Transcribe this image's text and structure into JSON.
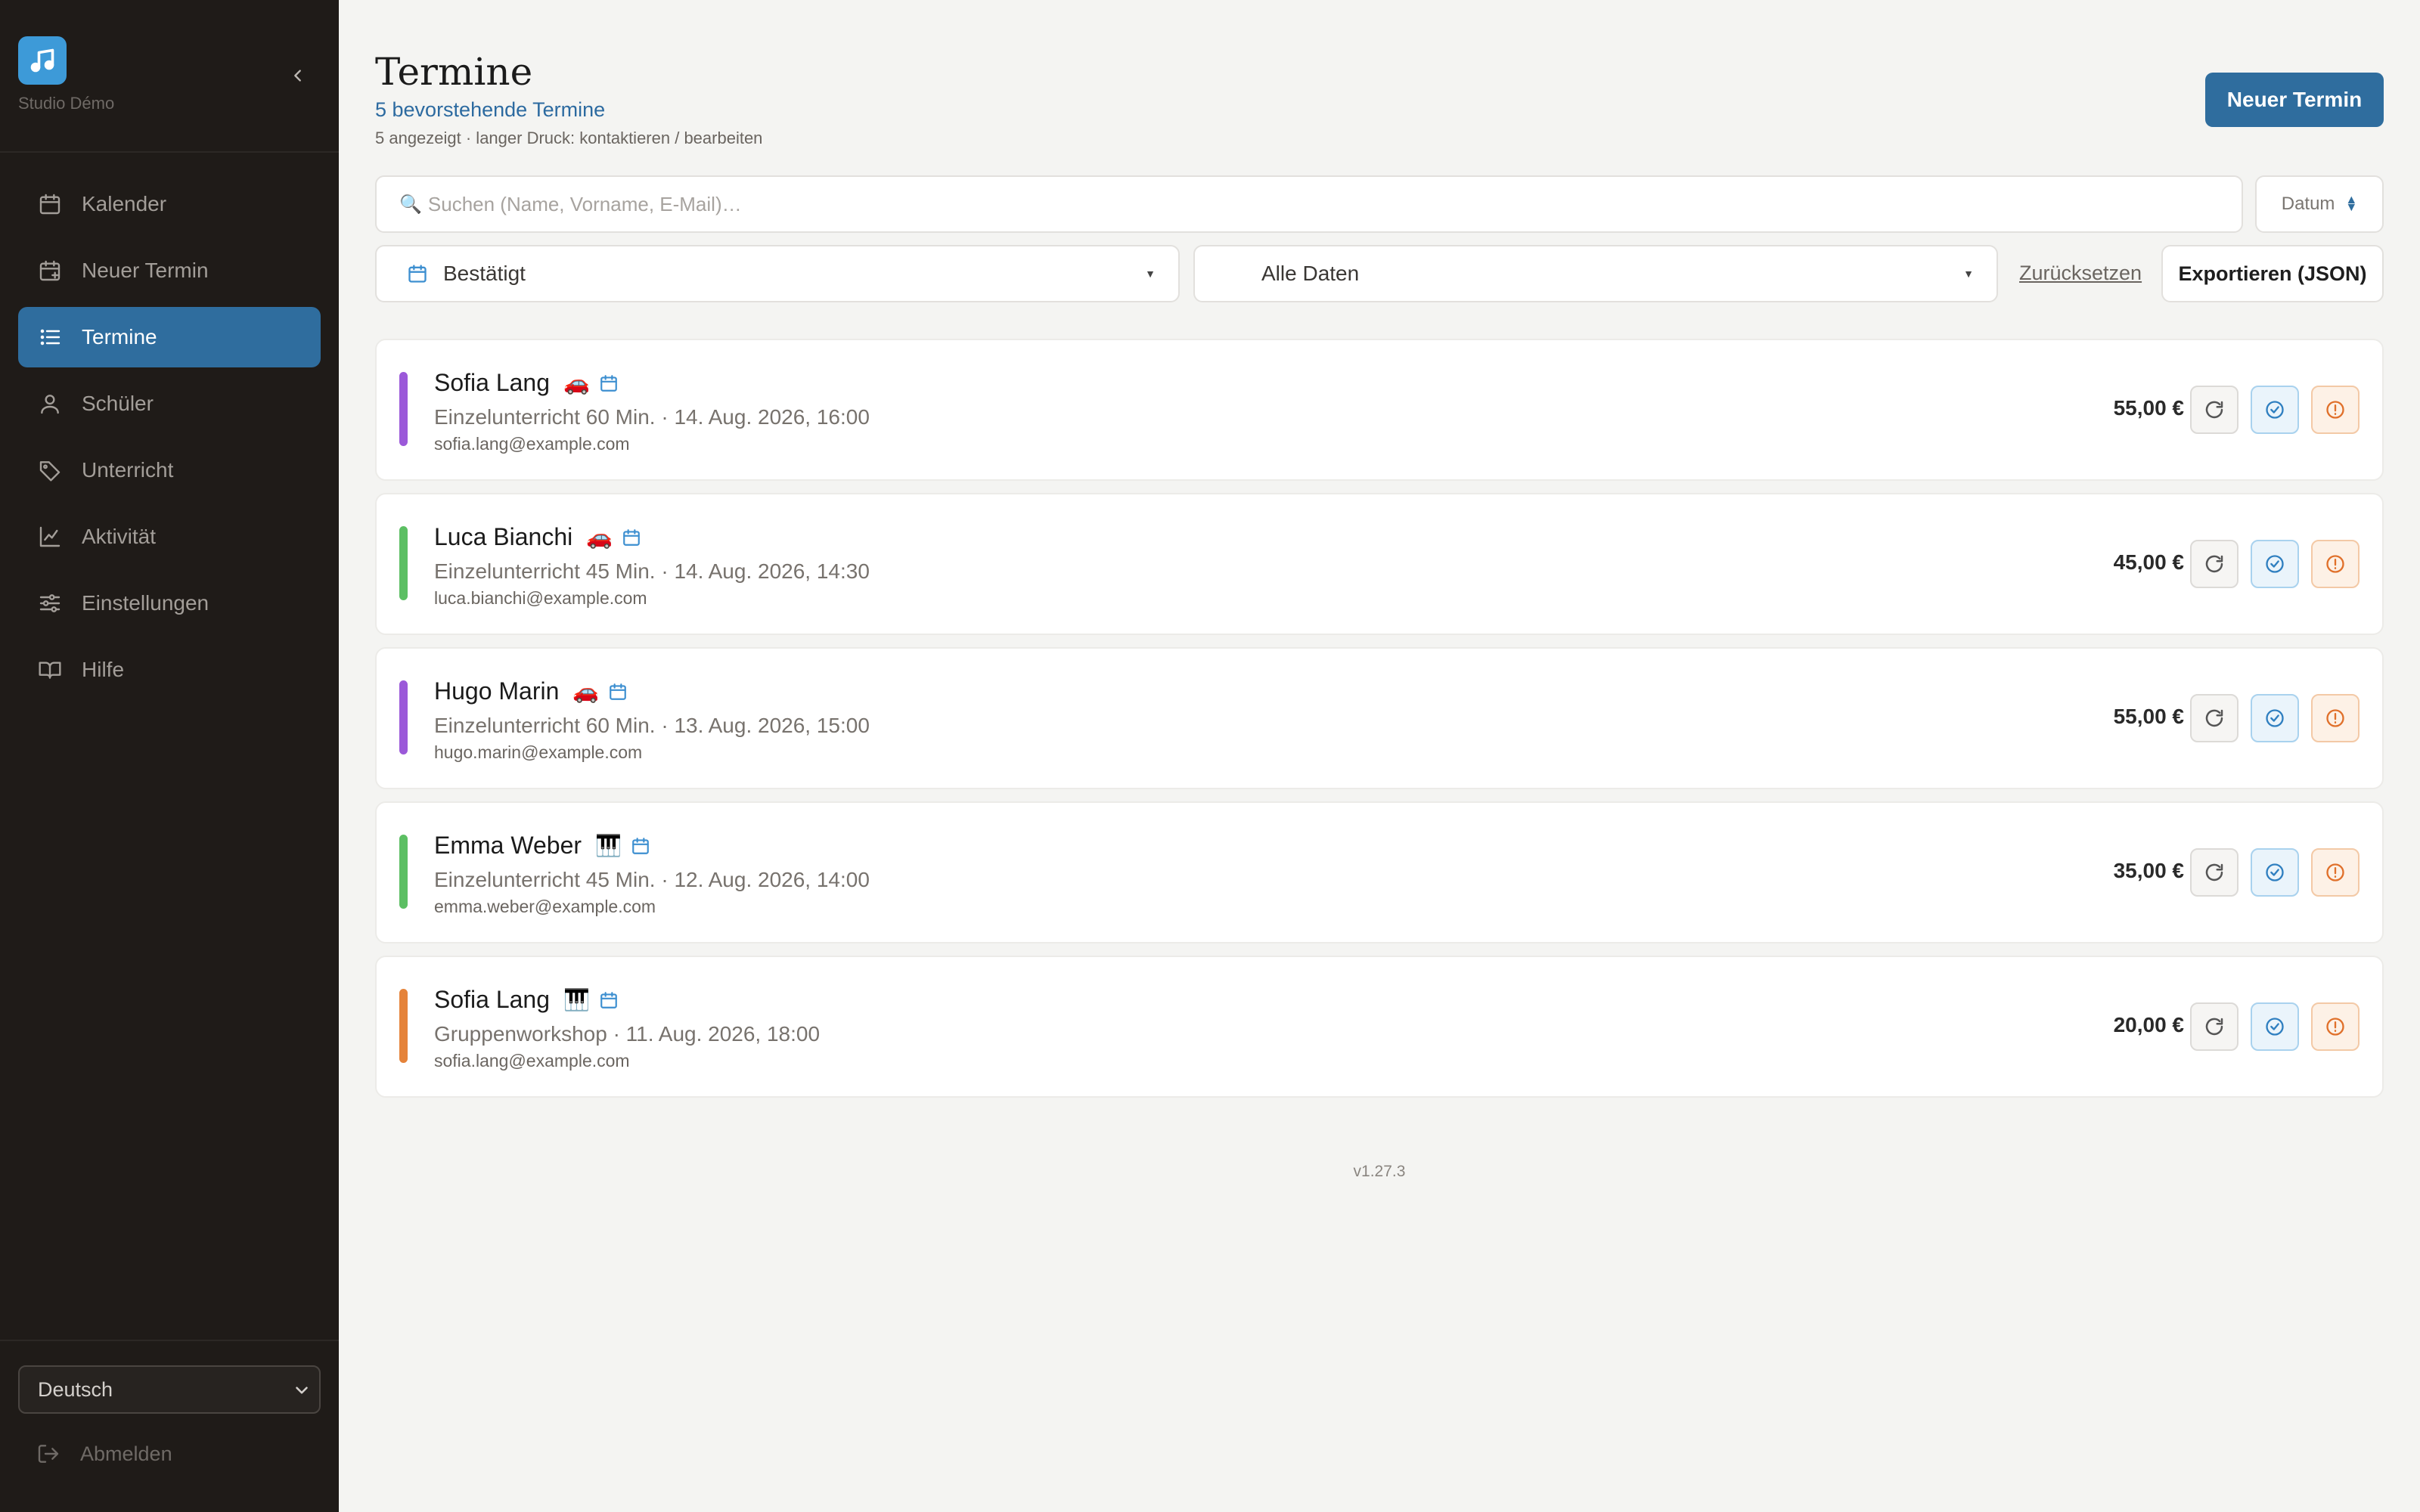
{
  "sidebar": {
    "brand_name": "Studio Démo",
    "nav": [
      {
        "label": "Kalender",
        "icon": "calendar-icon"
      },
      {
        "label": "Neuer Termin",
        "icon": "calendar-plus-icon"
      },
      {
        "label": "Termine",
        "icon": "list-icon",
        "active": true
      },
      {
        "label": "Schüler",
        "icon": "user-icon"
      },
      {
        "label": "Unterricht",
        "icon": "tag-icon"
      },
      {
        "label": "Aktivität",
        "icon": "chart-line-icon"
      },
      {
        "label": "Einstellungen",
        "icon": "sliders-icon"
      },
      {
        "label": "Hilfe",
        "icon": "book-icon"
      }
    ],
    "language": "Deutsch",
    "logout_label": "Abmelden"
  },
  "header": {
    "title": "Termine",
    "subtitle": "5 bevorstehende Termine",
    "hint": "5 angezeigt · langer Druck: kontaktieren / bearbeiten",
    "new_button": "Neuer Termin"
  },
  "filters": {
    "search_placeholder": "Suchen (Name, Vorname, E-Mail)…",
    "sort_label": "Datum",
    "status_value": "Bestätigt",
    "date_value": "Alle Daten",
    "reset_label": "Zurücksetzen",
    "export_label": "Exportieren (JSON)"
  },
  "appointments": [
    {
      "name": "Sofia Lang",
      "emoji": "🚗",
      "detail": "Einzelunterricht 60 Min. · 14. Aug. 2026, 16:00",
      "email": "sofia.lang@example.com",
      "price": "55,00 €",
      "color": "#9b59d9"
    },
    {
      "name": "Luca Bianchi",
      "emoji": "🚗",
      "detail": "Einzelunterricht 45 Min. · 14. Aug. 2026, 14:30",
      "email": "luca.bianchi@example.com",
      "price": "45,00 €",
      "color": "#5cbf63"
    },
    {
      "name": "Hugo Marin",
      "emoji": "🚗",
      "detail": "Einzelunterricht 60 Min. · 13. Aug. 2026, 15:00",
      "email": "hugo.marin@example.com",
      "price": "55,00 €",
      "color": "#9b59d9"
    },
    {
      "name": "Emma Weber",
      "emoji": "🎹",
      "detail": "Einzelunterricht 45 Min. · 12. Aug. 2026, 14:00",
      "email": "emma.weber@example.com",
      "price": "35,00 €",
      "color": "#5cbf63"
    },
    {
      "name": "Sofia Lang",
      "emoji": "🎹",
      "detail": "Gruppenworkshop · 11. Aug. 2026, 18:00",
      "email": "sofia.lang@example.com",
      "price": "20,00 €",
      "color": "#e5833a"
    }
  ],
  "footer": {
    "version": "v1.27.3"
  }
}
